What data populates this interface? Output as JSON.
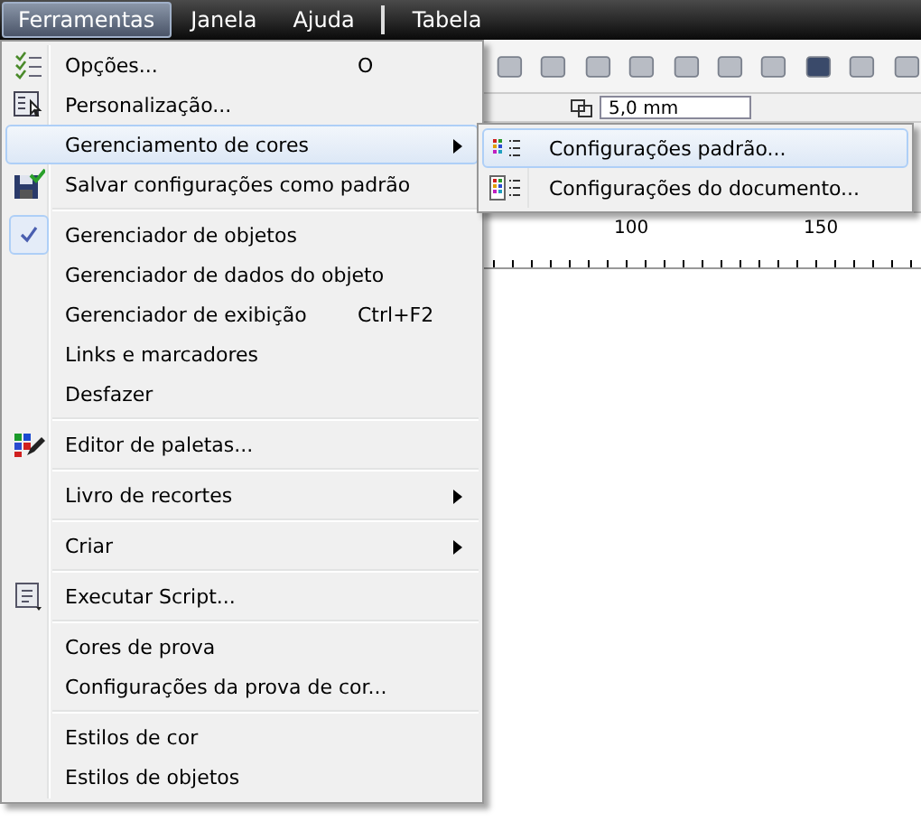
{
  "menubar": [
    {
      "label": "Ferramentas",
      "selected": true
    },
    {
      "label": "Janela",
      "selected": false
    },
    {
      "label": "Ajuda",
      "selected": false
    },
    {
      "label": "Tabela",
      "selected": false
    }
  ],
  "property_bar": {
    "value": "5,0 mm"
  },
  "ruler": {
    "labels": [
      "100",
      "150"
    ]
  },
  "menu": [
    {
      "kind": "item",
      "label": "Opções...",
      "shortcut": "O",
      "submenu": false,
      "selected": false,
      "checked": false
    },
    {
      "kind": "item",
      "label": "Personalização...",
      "submenu": false,
      "selected": false,
      "checked": false
    },
    {
      "kind": "item",
      "label": "Gerenciamento de cores",
      "submenu": true,
      "selected": true,
      "checked": false
    },
    {
      "kind": "item",
      "label": "Salvar configurações como padrão",
      "submenu": false,
      "selected": false,
      "checked": false
    },
    {
      "kind": "separator"
    },
    {
      "kind": "item",
      "label": "Gerenciador de objetos",
      "submenu": false,
      "selected": false,
      "checked": true
    },
    {
      "kind": "item",
      "label": "Gerenciador de dados do objeto",
      "submenu": false,
      "selected": false,
      "checked": false
    },
    {
      "kind": "item",
      "label": "Gerenciador de exibição",
      "shortcut": "Ctrl+F2",
      "submenu": false,
      "selected": false,
      "checked": false
    },
    {
      "kind": "item",
      "label": "Links e marcadores",
      "submenu": false,
      "selected": false,
      "checked": false
    },
    {
      "kind": "item",
      "label": "Desfazer",
      "submenu": false,
      "selected": false,
      "checked": false
    },
    {
      "kind": "separator"
    },
    {
      "kind": "item",
      "label": "Editor de paletas...",
      "submenu": false,
      "selected": false,
      "checked": false
    },
    {
      "kind": "separator"
    },
    {
      "kind": "item",
      "label": "Livro de recortes",
      "submenu": true,
      "selected": false,
      "checked": false
    },
    {
      "kind": "separator"
    },
    {
      "kind": "item",
      "label": "Criar",
      "submenu": true,
      "selected": false,
      "checked": false
    },
    {
      "kind": "separator"
    },
    {
      "kind": "item",
      "label": "Executar Script...",
      "submenu": false,
      "selected": false,
      "checked": false
    },
    {
      "kind": "separator"
    },
    {
      "kind": "item",
      "label": "Cores de prova",
      "submenu": false,
      "selected": false,
      "checked": false
    },
    {
      "kind": "item",
      "label": "Configurações da prova de cor...",
      "submenu": false,
      "selected": false,
      "checked": false
    },
    {
      "kind": "separator"
    },
    {
      "kind": "item",
      "label": "Estilos de cor",
      "submenu": false,
      "selected": false,
      "checked": false
    },
    {
      "kind": "item",
      "label": "Estilos de objetos",
      "submenu": false,
      "selected": false,
      "checked": false
    }
  ],
  "submenu": [
    {
      "label": "Configurações padrão...",
      "selected": true
    },
    {
      "label": "Configurações do documento...",
      "selected": false
    }
  ]
}
